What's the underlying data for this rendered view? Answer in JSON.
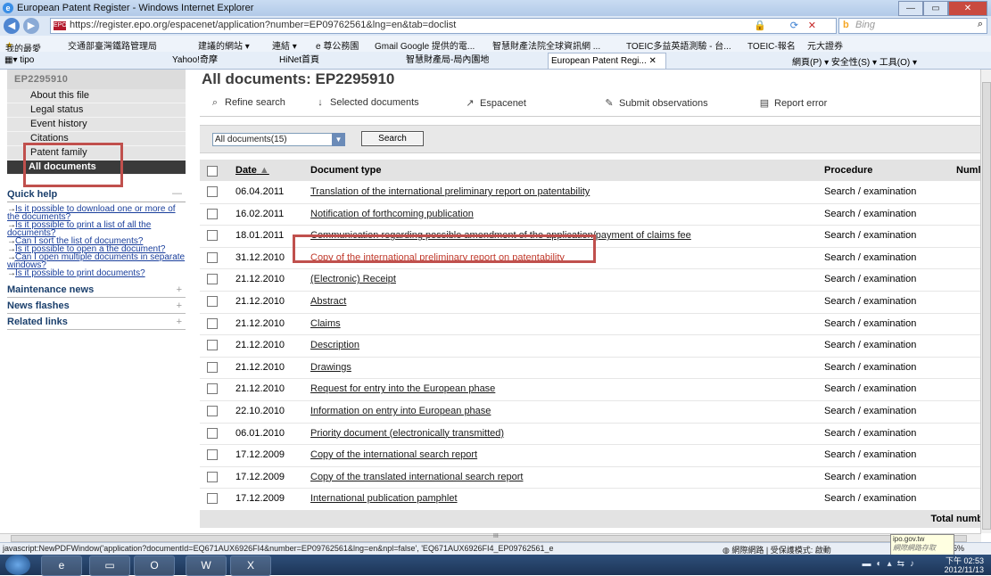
{
  "window": {
    "title": "European Patent Register - Windows Internet Explorer",
    "controls": [
      "—",
      "▭",
      "✕"
    ]
  },
  "address_bar": {
    "url": "https://register.epo.org/espacenet/application?number=EP09762561&lng=en&tab=doclist",
    "favicon_text": "EPO",
    "search_engine": "Bing"
  },
  "favorites_bar": {
    "items": [
      "我的最愛",
      "交通部臺灣鐵路管理局",
      "建議的網站 ▾",
      "連結 ▾",
      "e 尊公務園",
      "Gmail Google 提供的電...",
      "智慧財產法院全球資訊網 ...",
      "TOEIC多益英語測驗 - 台...",
      "TOEIC-報名",
      "元大證券"
    ]
  },
  "tabs_bar": {
    "tabs": [
      "tipo",
      "Yahoo!奇摩",
      "HiNet首頁",
      "智慧財產局-局內園地",
      "European Patent Regi..."
    ],
    "commands": "網頁(P) ▾  安全性(S) ▾  工具(O) ▾"
  },
  "sidebar": {
    "app_number": "EP2295910",
    "nav_items": [
      "About this file",
      "Legal status",
      "Event history",
      "Citations",
      "Patent family",
      "All documents"
    ],
    "active_index": 5,
    "quick_help": {
      "title": "Quick help",
      "links": [
        "Is it possible to download one or more of the documents?",
        "Is it possible to print a list of all the documents?",
        "Can I sort the list of documents?",
        "Is it possible to open a the document?",
        "Can I open multiple documents in separate windows?",
        "Is it possible to print documents?"
      ]
    },
    "sections": [
      "Maintenance news",
      "News flashes",
      "Related links"
    ]
  },
  "main": {
    "title": "All documents: EP2295910",
    "toolbar": {
      "refine": "Refine search",
      "selected": "Selected documents",
      "espacenet": "Espacenet",
      "submit": "Submit observations",
      "report": "Report error"
    },
    "filter": {
      "selected": "All documents(15)",
      "search_button": "Search"
    },
    "columns": {
      "date": "Date",
      "doctype": "Document type",
      "procedure": "Procedure",
      "number": "Numl"
    },
    "rows": [
      {
        "date": "06.04.2011",
        "type": "Translation of the international preliminary report on patentability",
        "procedure": "Search / examination"
      },
      {
        "date": "16.02.2011",
        "type": "Notification of forthcoming publication",
        "procedure": "Search / examination"
      },
      {
        "date": "18.01.2011",
        "type": "Communication regarding possible amendment of the application/payment of claims fee",
        "procedure": "Search / examination"
      },
      {
        "date": "31.12.2010",
        "type": "Copy of the international preliminary report on patentability",
        "procedure": "Search / examination"
      },
      {
        "date": "21.12.2010",
        "type": "(Electronic) Receipt",
        "procedure": "Search / examination"
      },
      {
        "date": "21.12.2010",
        "type": "Abstract",
        "procedure": "Search / examination"
      },
      {
        "date": "21.12.2010",
        "type": "Claims",
        "procedure": "Search / examination"
      },
      {
        "date": "21.12.2010",
        "type": "Description",
        "procedure": "Search / examination"
      },
      {
        "date": "21.12.2010",
        "type": "Drawings",
        "procedure": "Search / examination"
      },
      {
        "date": "21.12.2010",
        "type": "Request for entry into the European phase",
        "procedure": "Search / examination"
      },
      {
        "date": "22.10.2010",
        "type": "Information on entry into European phase",
        "procedure": "Search / examination"
      },
      {
        "date": "06.01.2010",
        "type": "Priority document (electronically transmitted)",
        "procedure": "Search / examination"
      },
      {
        "date": "17.12.2009",
        "type": "Copy of the international search report",
        "procedure": "Search / examination"
      },
      {
        "date": "17.12.2009",
        "type": "Copy of the translated international search report",
        "procedure": "Search / examination"
      },
      {
        "date": "17.12.2009",
        "type": "International publication pamphlet",
        "procedure": "Search / examination"
      }
    ],
    "highlighted_row": 3,
    "total": "Total numb"
  },
  "status_bar": {
    "link": "javascript:NewPDFWindow('application?documentId=EQ671AUX6926FI4&number=EP09762561&lng=en&npl=false', 'EQ671AUX6926FI4_EP09762561_e",
    "zone": "網際網路 | 受保護模式: 啟動",
    "zoom": "5%"
  },
  "tooltip": {
    "line1": "ipo.gov.tw",
    "line2": "網際網路存取"
  },
  "taskbar": {
    "time": "下午 02:53",
    "date": "2012/11/13"
  },
  "colors": {
    "highlight_box": "#c0504d",
    "sidebar_active": "#3a3a3a",
    "link_highlight": "#c0392b"
  }
}
